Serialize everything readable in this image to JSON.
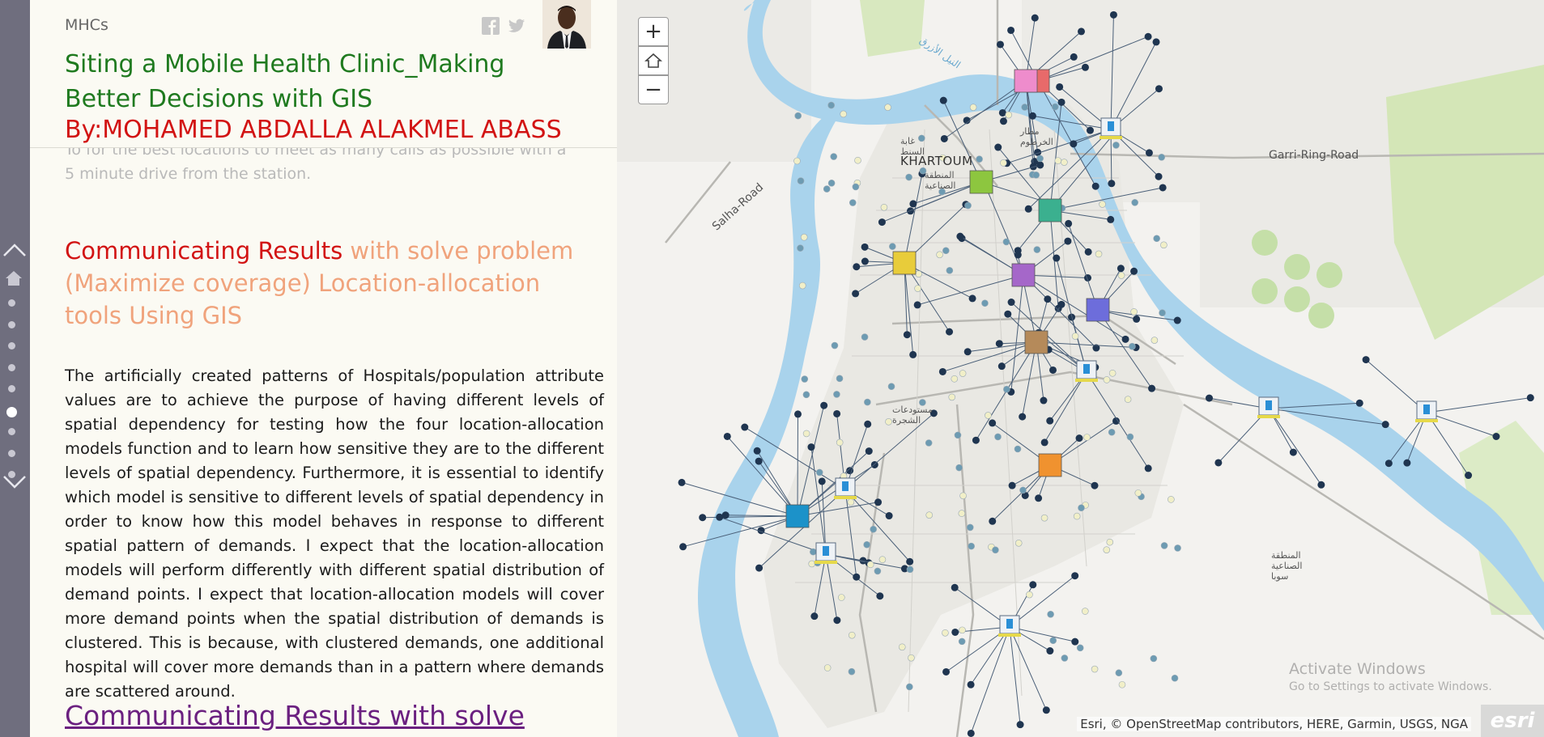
{
  "app": {
    "brand": "MHCs",
    "title": "Siting a Mobile Health Clinic_Making Better Decisions with GIS",
    "byline": "By:MOHAMED ABDALLA ALAKMEL ABASS"
  },
  "nav": {
    "dot_count": 9,
    "active_dot_index": 5
  },
  "content": {
    "faded_text": "To for the best locations to meet as many calls as possible with a 5 minute drive from the station.",
    "section_heading_red": "Communicating Results",
    "section_heading_orange": " with solve problem (Maximize coverage) Location-allocation tools Using GIS",
    "body": "The artificially created patterns of Hospitals/population attribute values are to achieve the purpose of having different levels of spatial dependency for testing how the four location-allocation models function and to learn how sensitive they are to the different levels of spatial dependency. Furthermore, it is essential to identify which model is sensitive to different levels of spatial dependency in order to know how this model behaves in response to different spatial pattern of demands. I expect that the location-allocation models will perform differently with different spatial distribution of demand points. I expect that location-allocation models will cover more demand points when the spatial distribution of demands is clustered. This is because, with clustered demands, one additional hospital will cover more demands than in a pattern where demands are scattered around.",
    "next_heading_link": "Communicating Results with solve"
  },
  "map": {
    "zoom_in": "+",
    "zoom_out": "−",
    "labels": {
      "khartoum": "KHARTOUM",
      "garri_road": "Garri-Ring-Road",
      "salha_road": "Salha-Road",
      "nile_ar": "النيل الأزرق",
      "airport_ar": "مطار الخرطوم",
      "forest_ar": "غابة السنط",
      "industrial_ar": "المنطقة الصناعية",
      "hospital_ar": "مستودعات الشجرة",
      "soba_ar": "المنطقة الصناعية سوبا"
    },
    "attribution": "Esri, © OpenStreetMap contributors, HERE, Garmin, USGS, NGA",
    "watermark_title": "Activate Windows",
    "watermark_sub": "Go to Settings to activate Windows.",
    "esri_logo": "esri",
    "colors": {
      "water": "#a9d3ec",
      "park": "#cfe3b0",
      "demand_dark": "#1f3550",
      "demand_mid": "#6d9bb2",
      "demand_light": "#f1efc8"
    }
  }
}
